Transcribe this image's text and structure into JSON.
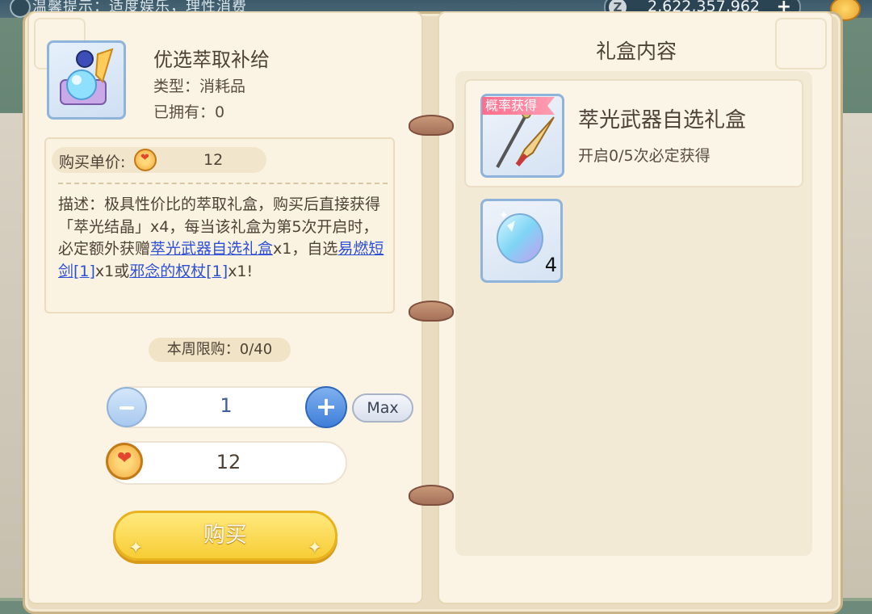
{
  "top_bar": {
    "tip_text": "温馨提示：适度娱乐，理性消费",
    "currency_symbol": "Z",
    "currency_amount": "2,622,357,962",
    "currency_plus": "+"
  },
  "item": {
    "icon": "gift-box-crystal-icon",
    "name": "优选萃取补给",
    "type_line": "类型：消耗品",
    "owned_line": "已拥有：0"
  },
  "purchase": {
    "unit_price_label": "购买单价:",
    "currency_icon": "heart-coin-icon",
    "unit_price": "12",
    "description": {
      "p1": "描述：极具性价比的萃取礼盒，购买后直接获得「萃光结晶」x4，每当该礼盒为第5次开启时，必定额外获赠",
      "link1": "萃光武器自选礼盒",
      "p2": "x1，自选",
      "link2": "易燃短剑[1]",
      "p3": "x1或",
      "link3": "邪念的权杖[1]",
      "p4": "x1!"
    },
    "weekly_limit": "本周限购：0/40",
    "quantity": "1",
    "max_label": "Max",
    "total": "12",
    "buy_label": "购买"
  },
  "gift_contents": {
    "title": "礼盒内容",
    "main_reward": {
      "tag": "概率获得",
      "name": "萃光武器自选礼盒",
      "subtitle": "开启0/5次必定获得",
      "icon": "weapons-icon"
    },
    "extra_reward": {
      "icon": "crystal-icon",
      "count": "4"
    }
  },
  "colors": {
    "paper": "#fbf4e4",
    "accent_blue": "#3f7fd8",
    "buy_yellow": "#f7cd35",
    "link_blue": "#2d4fd6",
    "tag_pink": "#ff6d8d"
  }
}
